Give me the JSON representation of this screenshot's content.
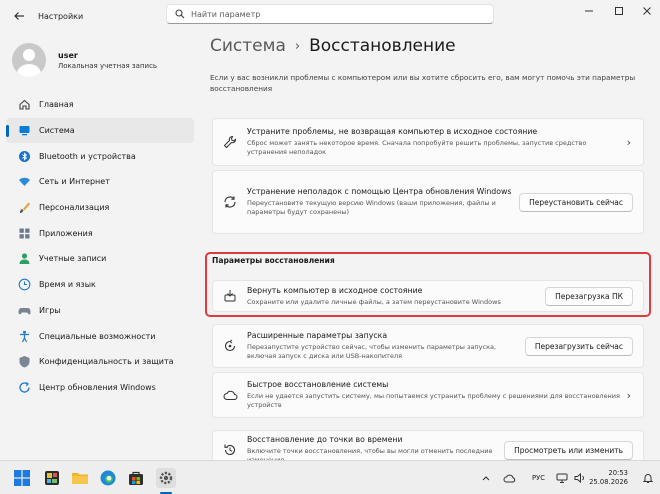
{
  "window": {
    "app_title": "Настройки",
    "search_placeholder": "Найти параметр"
  },
  "user": {
    "name": "user",
    "account_type": "Локальная учетная запись"
  },
  "nav": [
    {
      "label": "Главная",
      "icon": "home-icon",
      "active": false
    },
    {
      "label": "Система",
      "icon": "system-icon",
      "active": true
    },
    {
      "label": "Bluetooth и устройства",
      "icon": "bluetooth-icon",
      "active": false
    },
    {
      "label": "Сеть и Интернет",
      "icon": "wifi-icon",
      "active": false
    },
    {
      "label": "Персонализация",
      "icon": "brush-icon",
      "active": false
    },
    {
      "label": "Приложения",
      "icon": "apps-icon",
      "active": false
    },
    {
      "label": "Учетные записи",
      "icon": "accounts-icon",
      "active": false
    },
    {
      "label": "Время и язык",
      "icon": "globe-clock-icon",
      "active": false
    },
    {
      "label": "Игры",
      "icon": "gamepad-icon",
      "active": false
    },
    {
      "label": "Специальные возможности",
      "icon": "accessibility-icon",
      "active": false
    },
    {
      "label": "Конфиденциальность и защита",
      "icon": "shield-icon",
      "active": false
    },
    {
      "label": "Центр обновления Windows",
      "icon": "update-icon",
      "active": false
    }
  ],
  "page": {
    "breadcrumb_parent": "Система",
    "breadcrumb_separator": "›",
    "title": "Восстановление",
    "intro": "Если у вас возникли проблемы с компьютером или вы хотите сбросить его, вам могут помочь эти параметры восстановления",
    "section_label": "Параметры восстановления"
  },
  "cards": {
    "fix": {
      "title": "Устраните проблемы, не возвращая компьютер в исходное состояние",
      "desc": "Сброс может занять некоторое время. Сначала попробуйте решить проблемы, запустив средство устранения неполадок"
    },
    "wu": {
      "title": "Устранение неполадок с помощью Центра обновления Windows",
      "desc": "Переустановите текущую версию Windows (ваши приложения, файлы и параметры будут сохранены)",
      "button": "Переустановить сейчас"
    },
    "reset": {
      "title": "Вернуть компьютер в исходное состояние",
      "desc": "Сохраните или удалите личные файлы, а затем переустановите Windows",
      "button": "Перезагрузка ПК"
    },
    "advanced": {
      "title": "Расширенные параметры запуска",
      "desc": "Перезапустите устройство сейчас, чтобы изменить параметры запуска, включая запуск с диска или USB-накопителя",
      "button": "Перезагрузить сейчас"
    },
    "quick": {
      "title": "Быстрое восстановление системы",
      "desc": "Если не удается запустить систему, мы попытаемся устранить проблему с решениями для восстановления устройств"
    },
    "restore": {
      "title": "Восстановление до точки во времени",
      "desc": "Включите точки восстановления, чтобы вы могли отменить последние изменения",
      "button": "Просмотреть или изменить"
    }
  },
  "taskbar": {
    "language": "РУС",
    "time": "20:53",
    "date": "25.08.2026"
  },
  "colors": {
    "accent": "#0067c0",
    "highlight": "#e03b3b"
  }
}
